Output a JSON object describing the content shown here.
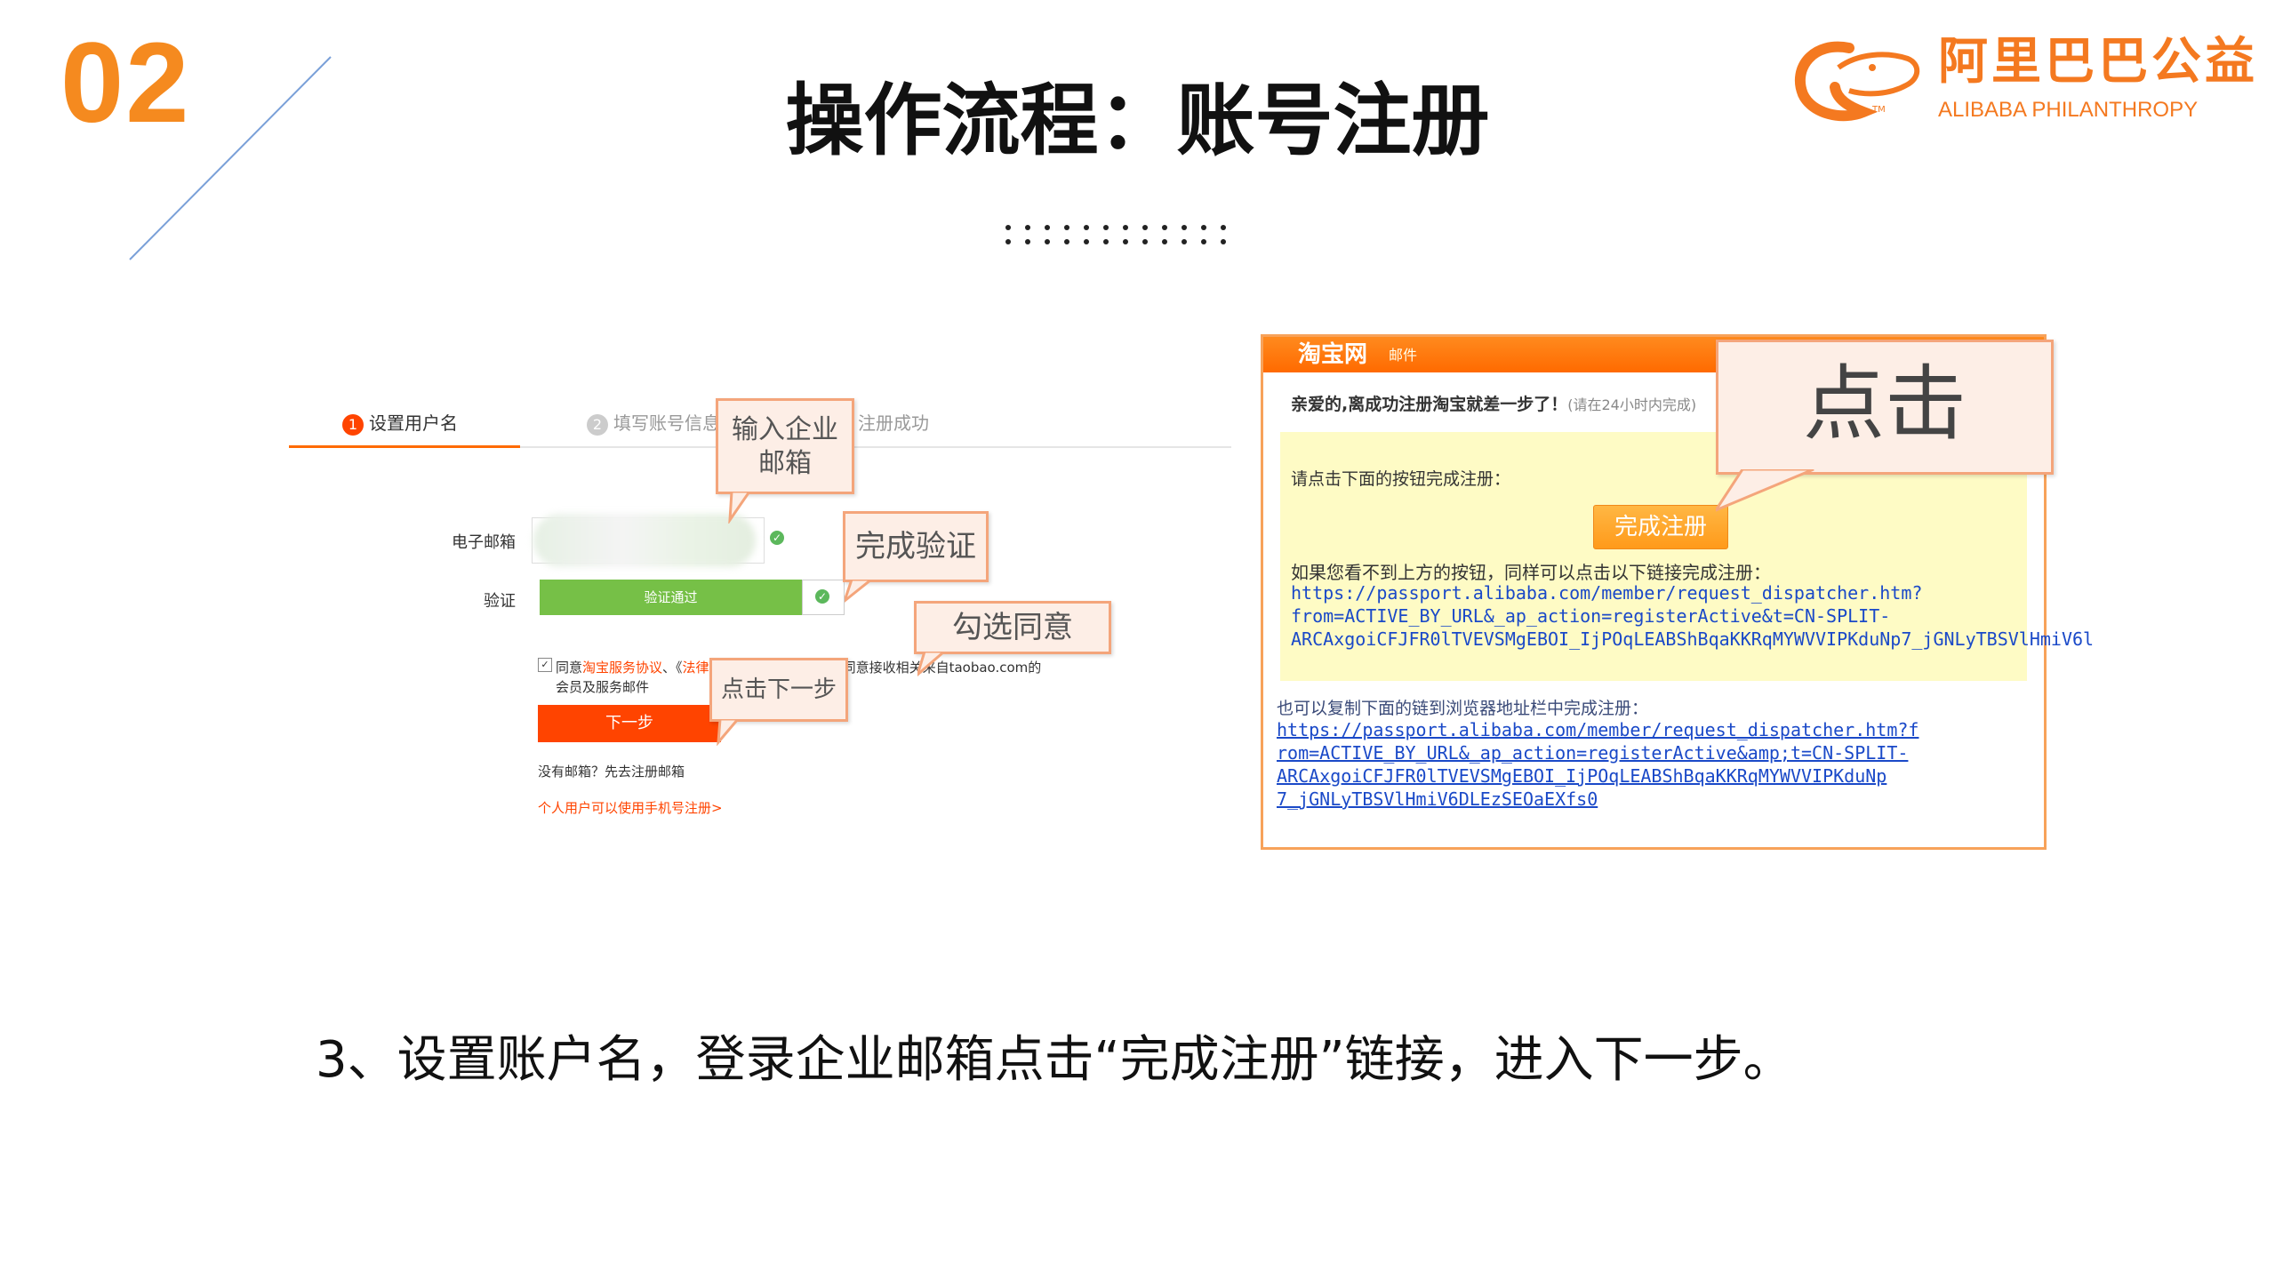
{
  "slide": {
    "number": "02",
    "title": "操作流程：账号注册",
    "caption": "3、设置账户名，登录企业邮箱点击“完成注册”链接，进入下一步。"
  },
  "logo": {
    "cn": "阿里巴巴公益",
    "en": "ALIBABA PHILANTHROPY",
    "tm": "TM"
  },
  "colors": {
    "accent": "#f58a1f",
    "taobao_orange": "#ff4400",
    "verify_green": "#76c047"
  },
  "register_form": {
    "steps": [
      {
        "num": "1",
        "label": "设置用户名"
      },
      {
        "num": "2",
        "label": "填写账号信息"
      },
      {
        "num": "",
        "label": "注册成功"
      }
    ],
    "email_label": "电子邮箱",
    "verify_label": "验证",
    "verify_status": "验证通过",
    "agree_prefix": "同意",
    "agree_link1": "淘宝服务协议",
    "agree_sep": "、《",
    "agree_link2": "法律声明及隐私权政策",
    "agree_mid": "》及同意接收相关来自taobao.com的",
    "agree_line2": "会员及服务邮件",
    "next_button": "下一步",
    "no_email": "没有邮箱？先去注册邮箱",
    "mobile_register": "个人用户可以使用手机号注册>"
  },
  "callouts": {
    "enter_email": "输入企业\n邮箱",
    "complete_verify": "完成验证",
    "check_agree": "勾选同意",
    "click_next": "点击下一步",
    "click": "点击"
  },
  "mail": {
    "brand": "淘宝网",
    "brand_sub": "邮件",
    "greeting": "亲爱的,离成功注册淘宝就差一步了！",
    "greeting_hint": "(请在24小时内完成)",
    "click_hint": "请点击下面的按钮完成注册：",
    "complete_button": "完成注册",
    "nolink_hint": "如果您看不到上方的按钮，同样可以点击以下链接完成注册：",
    "link1": [
      "https://passport.alibaba.com/member/request_dispatcher.htm?",
      "from=ACTIVE_BY_URL&_ap_action=registerActive&t=CN-SPLIT-",
      "ARCAxgoiCFJFR0lTVEVSMgEBOI_IjPOqLEABShBqaKKRqMYWVVIPKduNp7_jGNLyTBSVlHmiV6l"
    ],
    "copy_hint": "也可以复制下面的链到浏览器地址栏中完成注册：",
    "link2": [
      "https://passport.alibaba.com/member/request_dispatcher.htm?f",
      "rom=ACTIVE_BY_URL&_ap_action=registerActive&amp;t=CN-SPLIT-",
      "ARCAxgoiCFJFR0lTVEVSMgEBOI_IjPOqLEABShBqaKKRqMYWVVIPKduNp",
      "7_jGNLyTBSVlHmiV6DLEzSEOaEXfs0"
    ]
  }
}
